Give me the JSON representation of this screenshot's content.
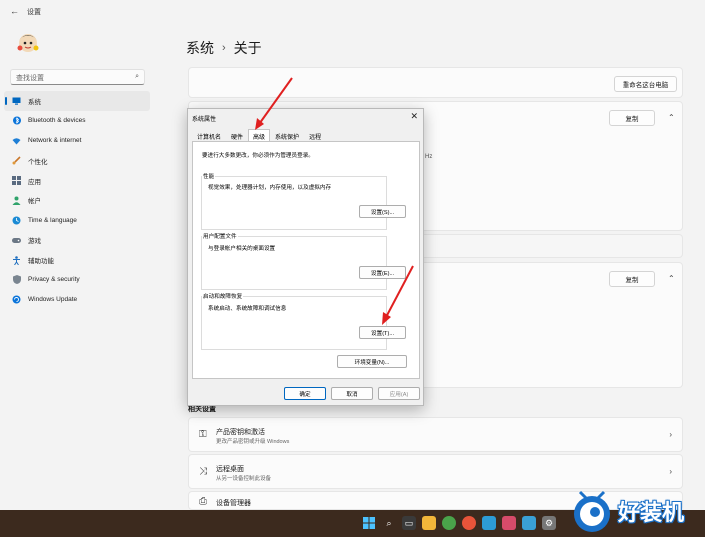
{
  "app": {
    "title": "设置",
    "back_icon": "back-arrow-icon"
  },
  "search": {
    "placeholder": "查找设置"
  },
  "nav": [
    {
      "label": "系统",
      "icon": "monitor-icon",
      "active": true
    },
    {
      "label": "Bluetooth & devices",
      "icon": "bluetooth-icon"
    },
    {
      "label": "Network & internet",
      "icon": "wifi-icon"
    },
    {
      "label": "个性化",
      "icon": "brush-icon"
    },
    {
      "label": "应用",
      "icon": "apps-icon"
    },
    {
      "label": "帐户",
      "icon": "person-icon"
    },
    {
      "label": "Time & language",
      "icon": "clock-globe-icon"
    },
    {
      "label": "游戏",
      "icon": "gamepad-icon"
    },
    {
      "label": "辅助功能",
      "icon": "accessibility-icon"
    },
    {
      "label": "Privacy & security",
      "icon": "shield-icon"
    },
    {
      "label": "Windows Update",
      "icon": "update-icon"
    }
  ],
  "breadcrumb": {
    "parent": "系统",
    "separator": "›",
    "current": "关于"
  },
  "main": {
    "rename_button": "重命名这台电脑",
    "copy_button_1": "复制",
    "copy_button_2": "复制",
    "partial_text": "Hz",
    "related_title": "相关设置",
    "related": [
      {
        "title": "产品密钥和激活",
        "desc": "更改产品密钥或升级 Windows",
        "icon": "key-icon"
      },
      {
        "title": "远程桌面",
        "desc": "从另一设备控制此设备",
        "icon": "remote-desktop-icon"
      },
      {
        "title": "设备管理器",
        "desc": "",
        "icon": "printer-icon"
      }
    ]
  },
  "dialog": {
    "title": "系统属性",
    "tabs": [
      "计算机名",
      "硬件",
      "高级",
      "系统保护",
      "远程"
    ],
    "active_tab": "高级",
    "admin_note": "要进行大多数更改，你必须作为管理员登录。",
    "performance": {
      "label": "性能",
      "desc": "视觉效果，处理器计划，内存使用，以及虚拟内存",
      "button": "设置(S)..."
    },
    "profiles": {
      "label": "用户配置文件",
      "desc": "与登录帐户相关的桌面设置",
      "button": "设置(E)..."
    },
    "startup": {
      "label": "启动和故障恢复",
      "desc": "系统启动、系统故障和调试信息",
      "button": "设置(T)..."
    },
    "env_button": "环境变量(N)...",
    "ok": "确定",
    "cancel": "取消",
    "apply": "应用(A)"
  },
  "watermark": {
    "text": "好装机"
  },
  "colors": {
    "accent": "#0067c0",
    "arrow": "#e02020",
    "taskbar": "#3c2a1e"
  }
}
